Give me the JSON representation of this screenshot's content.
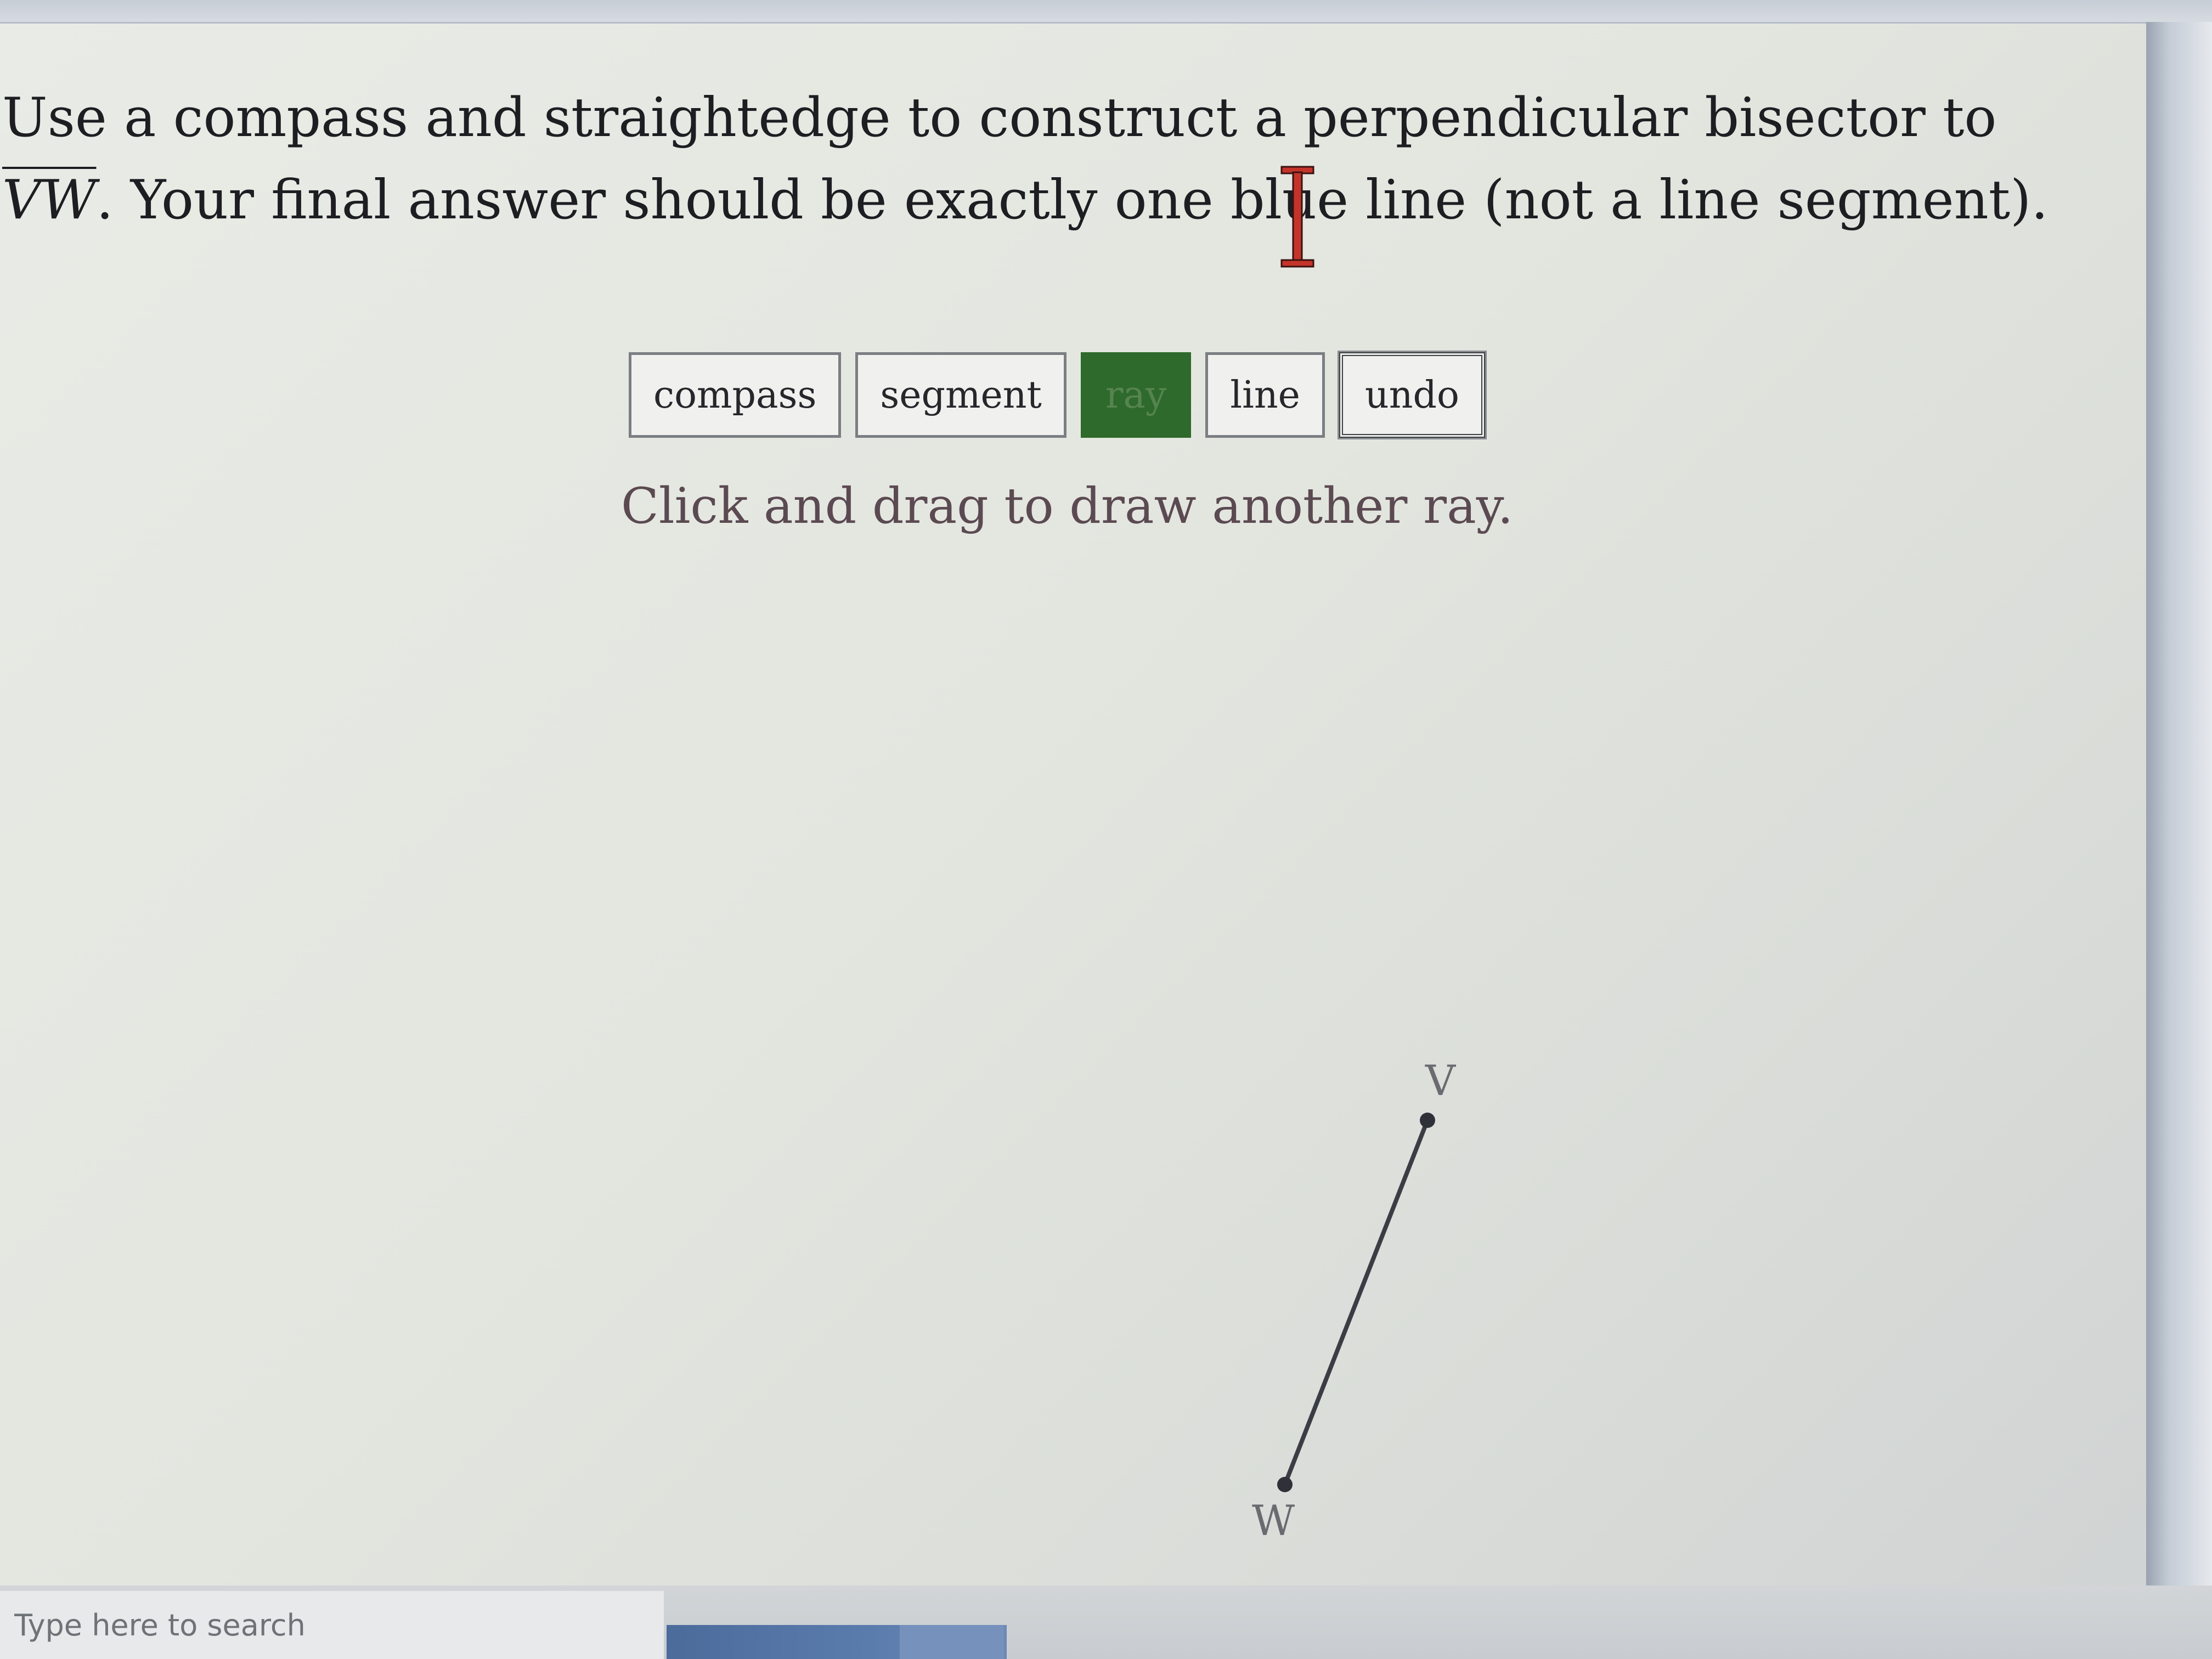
{
  "prompt": {
    "text_before": "Use a compass and straightedge to construct a perpendicular bisector to ",
    "segment_name": "VW",
    "text_after": ". Your final answer should be exactly one blue line (not a line segment)."
  },
  "toolbar": {
    "compass_label": "compass",
    "segment_label": "segment",
    "ray_label": "ray",
    "line_label": "line",
    "undo_label": "undo",
    "active_tool": "ray",
    "active_color": "#2e6a2b"
  },
  "instruction": "Click and drag to draw another ray.",
  "figure": {
    "point_v_label": "V",
    "point_w_label": "W"
  },
  "taskbar": {
    "search_placeholder": "Type here to search"
  }
}
